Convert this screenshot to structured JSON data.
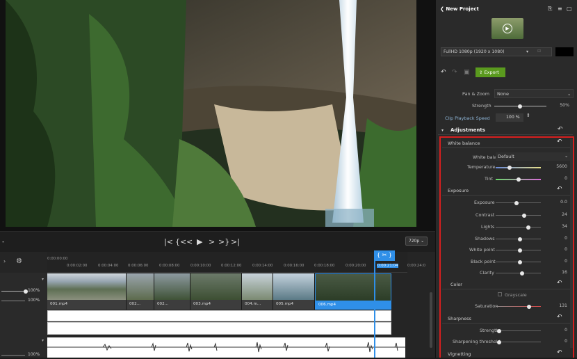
{
  "header": {
    "back_label": "New Project"
  },
  "project": {
    "resolution": "FullHD 1080p (1920 x 1080)"
  },
  "toolbar": {
    "export_label": "Export"
  },
  "clip_settings": {
    "pan_zoom_label": "Pan & Zoom",
    "pan_zoom_value": "None",
    "strength_label": "Strength",
    "strength_value": "50%",
    "speed_label": "Clip Playback Speed",
    "speed_value": "100 %"
  },
  "adjustments": {
    "title": "Adjustments",
    "white_balance": {
      "title": "White balance",
      "wb_label": "White balance",
      "wb_value": "Default",
      "temperature_label": "Temperature",
      "temperature_value": "5600",
      "tint_label": "Tint",
      "tint_value": "0"
    },
    "exposure": {
      "title": "Exposure",
      "rows": [
        {
          "label": "Exposure",
          "value": "0.0",
          "pos": 0.4
        },
        {
          "label": "Contrast",
          "value": "24",
          "pos": 0.62
        },
        {
          "label": "Lights",
          "value": "34",
          "pos": 0.67
        },
        {
          "label": "Shadows",
          "value": "0",
          "pos": 0.5
        },
        {
          "label": "White point",
          "value": "0",
          "pos": 0.5
        },
        {
          "label": "Black point",
          "value": "0",
          "pos": 0.5
        },
        {
          "label": "Clarity",
          "value": "16",
          "pos": 0.58
        }
      ]
    },
    "color": {
      "title": "Color",
      "grayscale_label": "Grayscale",
      "saturation_label": "Saturation",
      "saturation_value": "131"
    },
    "sharpness": {
      "title": "Sharpness",
      "strength_label": "Strength",
      "strength_value": "0",
      "threshold_label": "Sharpening threshold",
      "threshold_value": "0"
    },
    "vignetting": {
      "title": "Vignetting"
    }
  },
  "player": {
    "quality": "720p"
  },
  "timeline": {
    "ticks": [
      "0:00:00:00",
      "0:00:02:00",
      "0:00:04:00",
      "0:00:06:00",
      "0:00:08:00",
      "0:00:10:00",
      "0:00:12:00",
      "0:00:14:00",
      "0:00:16:00",
      "0:00:18:00",
      "0:00:20:00",
      "0:00:21:04",
      "0:00:24:0"
    ],
    "current_time": "0:00:21:04",
    "video_volume": "100%",
    "audio_volume_top": "100%",
    "audio_volume": "100%",
    "clips": [
      {
        "name": "001.mp4"
      },
      {
        "name": "002..."
      },
      {
        "name": "002..."
      },
      {
        "name": "003.mp4"
      },
      {
        "name": "004.m..."
      },
      {
        "name": "005.mp4"
      },
      {
        "name": "006.mp4"
      }
    ]
  },
  "colors": {
    "accent": "#2f8fe8",
    "export_green": "#5a9a1e",
    "highlight_red": "#d81e1e"
  }
}
